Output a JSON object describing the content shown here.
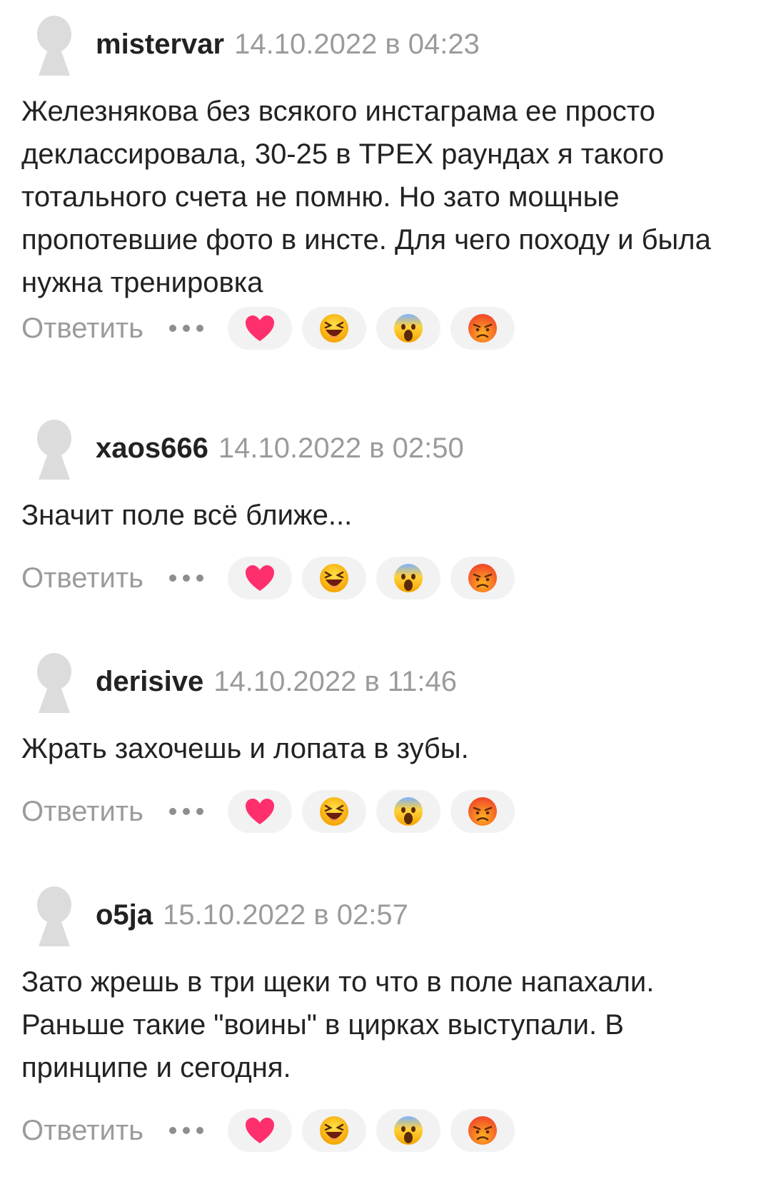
{
  "ui": {
    "reply_label": "Ответить",
    "more_menu_icon": "three-dots-icon",
    "reactions": [
      "heart-icon",
      "laughing-face-icon",
      "scared-face-icon",
      "angry-face-icon"
    ]
  },
  "colors": {
    "text": "#222222",
    "muted": "#9b9b9b",
    "pill_bg": "#f2f2f2",
    "avatar": "#dcdcdc"
  },
  "comments": [
    {
      "author": "mistervar",
      "date": "14.10.2022 в 04:23",
      "text": "Железнякова без всякого инстаграма ее просто деклассировала, 30-25 в ТРЕХ раундах я такого тотального счета не помню. Но зато мощные пропотевшие фото в инсте. Для чего походу и была нужна тренировка"
    },
    {
      "author": "xaos666",
      "date": "14.10.2022 в 02:50",
      "text": "Значит поле всё ближе..."
    },
    {
      "author": "derisive",
      "date": "14.10.2022 в 11:46",
      "text": "Жрать захочешь и лопата в зубы."
    },
    {
      "author": "o5ja",
      "date": "15.10.2022 в 02:57",
      "text": "Зато жрешь в три щеки то что в поле напахали. Раньше такие \"воины\" в цирках выступали. В принципе и сегодня."
    }
  ]
}
